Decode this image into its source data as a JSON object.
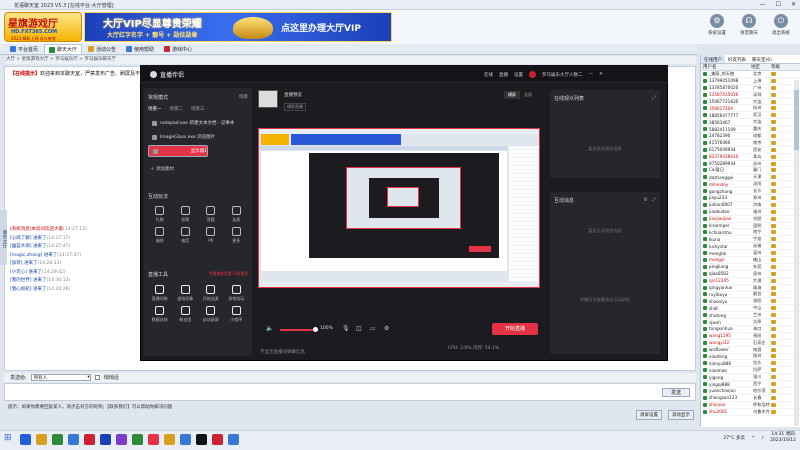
{
  "window_title": "花语聊天室 2023 V5.3 [在线平台-大厅管理]",
  "banner": {
    "logo_title": "星旗游戏厅",
    "logo_site": "HD.FXT365.COM",
    "logo_slogan": "2023 精彩上线 永久有效",
    "ad_line1": "大厅VIP尽显尊贵荣耀",
    "ad_line2": "大厅红字名字 + 靓号 + 勋炫勋章",
    "ad_cta": "点这里办理大厅VIP"
  },
  "top_icons": [
    {
      "label": "系统设置",
      "icon": "gear-icon"
    },
    {
      "label": "语音聊天",
      "icon": "headset-icon"
    },
    {
      "label": "退出系统",
      "icon": "power-icon"
    }
  ],
  "tabs": [
    {
      "label": "平台首页",
      "color": "#3a78d8",
      "active": false
    },
    {
      "label": "聊天大厅",
      "color": "#2a8c3a",
      "active": true
    },
    {
      "label": "活动公告",
      "color": "#d8a020",
      "active": false
    },
    {
      "label": "使用帮助",
      "color": "#3a78d8",
      "active": false
    },
    {
      "label": "游戏中心",
      "color": "#c23",
      "active": false
    }
  ],
  "breadcrumb": "大厅 > 星旗游戏大厅 > 罗马娱乐厅 > 罗马娱乐聊天厅",
  "notice": {
    "tag": "【在线提示】",
    "text": "欢迎来到本聊天室，严禁发布广告、刷屏及不良信息，共同维护良好的聊天环境！"
  },
  "side_hint": "聊天大厅",
  "messages": [
    {
      "text": "[系统消息]本房间欢迎大家",
      "time": "(14:27:13)",
      "first": true
    },
    {
      "text": "[心碎了解] 进来了",
      "time": "(14:27:17)"
    },
    {
      "text": "[幽蓝水滴] 进来了",
      "time": "(14:27:47)"
    },
    {
      "text": "[magic.zhang] 进来了",
      "time": "(14:27:47)"
    },
    {
      "text": "[加菲] 进来了",
      "time": "(14:28:13)"
    },
    {
      "text": "[小可心] 进来了",
      "time": "(14:29:42)"
    },
    {
      "text": "[我的世界] 进来了",
      "time": "(14:30:13)"
    },
    {
      "text": "[我心如初] 进来了",
      "time": "(14:30:28)"
    }
  ],
  "input_row": {
    "label": "发送给:",
    "target": "所有人",
    "whisper": "悄悄话"
  },
  "send_label": "发送",
  "tips": "提示：如果你需要回复某人，请点击对方的昵称；【联系我们】可以帮助你解决问题",
  "bottom_buttons": [
    "清屏设置",
    "滚动显示"
  ],
  "right_panel": {
    "tabs": [
      "在线用户",
      "好友列表",
      "聊天室(6)"
    ],
    "headers": [
      "用户名",
      "地区",
      "等级"
    ],
    "users": [
      [
        "_美丽_的天使",
        "北京"
      ],
      [
        "13799051098",
        "上海"
      ],
      [
        "13785870020",
        "广州"
      ],
      [
        "13587015936",
        "深圳"
      ],
      [
        "15067721830",
        "大连"
      ],
      [
        "35661720A",
        "杭州"
      ],
      [
        "18856477777",
        "武汉"
      ],
      [
        "38563467",
        "大连"
      ],
      [
        "5882411109",
        "重庆"
      ],
      [
        "24782390",
        "成都"
      ],
      [
        "41576460",
        "南京"
      ],
      [
        "6175049934",
        "西安"
      ],
      [
        "82379438610",
        "青岛"
      ],
      [
        "9750289934",
        "苏州"
      ],
      [
        "Cai爱日",
        "厦门"
      ],
      [
        "dazhanggui",
        "天津"
      ],
      [
        "dimeiday",
        "沈阳"
      ],
      [
        "gongzhang",
        "长沙"
      ],
      [
        "jiayu233",
        "郑州"
      ],
      [
        "jiahan0807",
        "济南"
      ],
      [
        "jiaobudao",
        "福州"
      ],
      [
        "jiaojiaojiao",
        "合肥"
      ],
      [
        "kisiemper",
        "昆明"
      ],
      [
        "lichuanzhu",
        "南宁"
      ],
      [
        "lkuna",
        "宁波"
      ],
      [
        "luckystar",
        "无锡"
      ],
      [
        "mengtai",
        "温州"
      ],
      [
        "mongyi",
        "佛山"
      ],
      [
        "pingliang",
        "东莞"
      ],
      [
        "qiao8582",
        "泉州"
      ],
      [
        "qin12345",
        "大理"
      ],
      [
        "qingyanluo",
        "珠海"
      ],
      [
        "ruyibuyu",
        "烟台"
      ],
      [
        "shaosiyu",
        "洛阳"
      ],
      [
        "shi8",
        "中山"
      ],
      [
        "shutong",
        "兰州"
      ],
      [
        "sjwxh",
        "太原"
      ],
      [
        "tongxinhua",
        "海口"
      ],
      [
        "wang1295",
        "贵阳"
      ],
      [
        "wangyi22",
        "石家庄"
      ],
      [
        "wisflower",
        "南昌"
      ],
      [
        "xiaofeng",
        "扬州"
      ],
      [
        "xianyu888",
        "包头"
      ],
      [
        "xiaomao",
        "拉萨"
      ],
      [
        "yigong",
        "银川"
      ],
      [
        "yingqi888",
        "西宁"
      ],
      [
        "yuanchaojun",
        "哈尔滨"
      ],
      [
        "zhangsan123",
        "长春"
      ],
      [
        "zhiyuan",
        "呼和浩特"
      ],
      [
        "zhu2001",
        "乌鲁木齐"
      ]
    ]
  },
  "obs": {
    "title": "直播伴侣",
    "top_actions": [
      "在线",
      "直播",
      "设置"
    ],
    "user": "罗马娱乐大厅人数二",
    "scene_header": "常规模式",
    "scene_mode": "场景",
    "scene_tabs": [
      "场景一",
      "场景二",
      "场景三"
    ],
    "sources": [
      "notepad.exe 新建文本文档 - 记事本",
      "ImageGlass.exe 浏览图片",
      "显示器1"
    ],
    "add_source": "添加素材",
    "interaction_header": "互动玩法",
    "interaction_items": [
      "礼物",
      "投票",
      "答题",
      "连麦",
      "福袋",
      "抽奖",
      "PK",
      "更多"
    ],
    "tools_header": "直播工具",
    "tools_note": "专属美颜设置 开启更多",
    "tools": [
      "直播间装",
      "虚拟形象",
      "开始连麦",
      "游戏陪玩",
      "数据总结",
      "粉丝团",
      "自动录屏",
      "小程序"
    ],
    "preview_label": "直播预览",
    "preview_sub": "横屏直播",
    "orient": [
      "横屏",
      "竖屏"
    ],
    "volume": "100%",
    "start_label": "开始直播",
    "stats": "CPU: 3.6%   内存: 54.1%",
    "footer_note": "不显示直播间弹幕信息",
    "online_audience": "在线观众列表",
    "audience_empty": "暂无在线观众信息",
    "chat_header": "互动消息",
    "chat_empty": "暂无互动消息内容",
    "chat_hint": "开播后可查看观众互动消息"
  },
  "taskbar": {
    "weather": "27°C 多云",
    "time": "14:31 周四",
    "date": "2023/10/12",
    "apps": [
      "#2060d8",
      "#d8a020",
      "#2a8c3a",
      "#3a78d8",
      "#c23",
      "#1b3fb8",
      "#7a3cc8",
      "#2a8c3a",
      "#e33345",
      "#d8a020",
      "#3a78d8",
      "#111",
      "#c23",
      "#3a78d8"
    ]
  }
}
